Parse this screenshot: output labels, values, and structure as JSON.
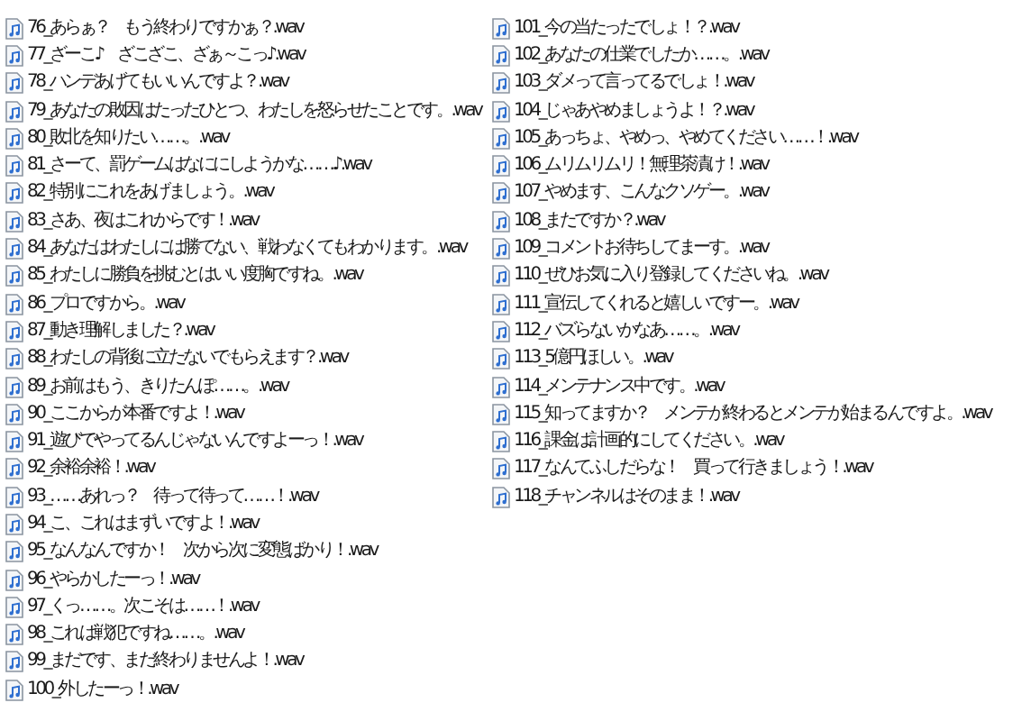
{
  "files": [
    {
      "name": "76_あらぁ？　もう終わりですかぁ？.wav"
    },
    {
      "name": "77_ざーこ♪　ざこざこ、ざぁ～こっ♪.wav"
    },
    {
      "name": "78_ハンデあげてもいいんですよ？.wav"
    },
    {
      "name": "79_あなたの敗因はたったひとつ、わたしを怒らせたことです。.wav"
    },
    {
      "name": "80_敗北を知りたい……。.wav"
    },
    {
      "name": "81_さーて、罰ゲームはなににしようかな……♪.wav"
    },
    {
      "name": "82_特別にこれをあげましょう。.wav"
    },
    {
      "name": "83_さあ、夜はこれからです！.wav"
    },
    {
      "name": "84_あなたはわたしには勝てない、戦わなくてもわかります。.wav"
    },
    {
      "name": "85_わたしに勝負を挑むとはいい度胸ですね。.wav"
    },
    {
      "name": "86_プロですから。.wav"
    },
    {
      "name": "87_動き理解しました？.wav"
    },
    {
      "name": "88_わたしの背後に立たないでもらえます？.wav"
    },
    {
      "name": "89_お前はもう、きりたんぽ……。.wav"
    },
    {
      "name": "90_ここからが本番ですよ！.wav"
    },
    {
      "name": "91_遊びでやってるんじゃないんですよーっ！.wav"
    },
    {
      "name": "92_余裕余裕！.wav"
    },
    {
      "name": "93_……あれっ？　待って待って……！.wav"
    },
    {
      "name": "94_こ、これはまずいですよ！.wav"
    },
    {
      "name": "95_なんなんですか！　次から次に変態ばかり！.wav"
    },
    {
      "name": "96_やらかしたーっ！.wav"
    },
    {
      "name": "97_くっ……。次こそは……！.wav"
    },
    {
      "name": "98_これは戦犯ですね……。.wav"
    },
    {
      "name": "99_まだです、まだ終わりませんよ！.wav"
    },
    {
      "name": "100_外したーっ！.wav"
    },
    {
      "name": "101_今の当たったでしょ！？.wav"
    },
    {
      "name": "102_あなたの仕業でしたか……。.wav"
    },
    {
      "name": "103_ダメって言ってるでしょ！.wav"
    },
    {
      "name": "104_じゃあやめましょうよ！？.wav"
    },
    {
      "name": "105_あっちょ、やめっ、やめてください……！.wav"
    },
    {
      "name": "106_ムリムリムリ！無理茶漬け！.wav"
    },
    {
      "name": "107_やめます、こんなクソゲー。.wav"
    },
    {
      "name": "108_またですか？.wav"
    },
    {
      "name": "109_コメントお待ちしてまーす。.wav"
    },
    {
      "name": "110_ぜひお気に入り登録してくださいね。.wav"
    },
    {
      "name": "111_宣伝してくれると嬉しいですー。.wav"
    },
    {
      "name": "112_バズらないかなあ……。.wav"
    },
    {
      "name": "113_5億円ほしい。.wav"
    },
    {
      "name": "114_メンテナンス中です。.wav"
    },
    {
      "name": "115_知ってますか？　メンテが終わるとメンテが始まるんですよ。.wav"
    },
    {
      "name": "116_課金は計画的にしてください。.wav"
    },
    {
      "name": "117_なんてふしだらな！　買って行きましょう！.wav"
    },
    {
      "name": "118_チャンネルはそのまま！.wav"
    }
  ]
}
